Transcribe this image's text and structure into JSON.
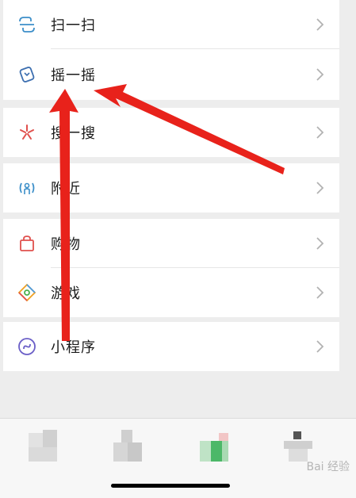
{
  "menu": {
    "group1": [
      {
        "label": "扫一扫",
        "icon": "scan-icon"
      },
      {
        "label": "摇一摇",
        "icon": "shake-icon"
      }
    ],
    "group2": [
      {
        "label": "搜一搜",
        "icon": "search-star-icon"
      }
    ],
    "group3": [
      {
        "label": "附近",
        "icon": "nearby-icon"
      }
    ],
    "group4": [
      {
        "label": "购物",
        "icon": "shopping-bag-icon"
      },
      {
        "label": "游戏",
        "icon": "game-icon"
      }
    ],
    "group5": [
      {
        "label": "小程序",
        "icon": "mini-program-icon"
      }
    ]
  },
  "watermark": "Bai 经验",
  "colors": {
    "arrow": "#e8221b",
    "background": "#ededed",
    "row": "#ffffff"
  }
}
